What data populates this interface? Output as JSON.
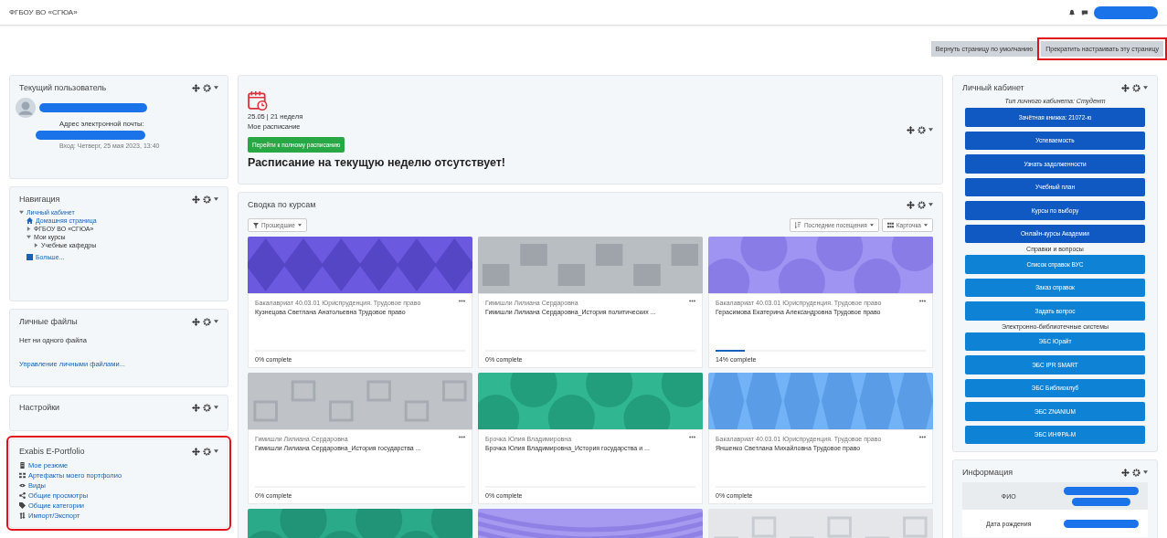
{
  "header": {
    "site_name": "ФГБОУ ВО «СГЮА»"
  },
  "page_buttons": [
    {
      "label": "Вернуть страницу по умолчанию",
      "highlighted": false
    },
    {
      "label": "Прекратить настраивать эту страницу",
      "highlighted": true
    }
  ],
  "current_user_block": {
    "title": "Текущий пользователь",
    "email_label": "Адрес электронной почты:",
    "last_login": "Вход: Четверг, 25 мая 2023, 13:40"
  },
  "navigation_block": {
    "title": "Навигация",
    "tree": [
      {
        "label": "Личный кабинет",
        "kind": "folder",
        "expanded": true,
        "children": [
          {
            "label": "Домашняя страница",
            "kind": "home"
          },
          {
            "label": "ФГБОУ ВО «СГЮА»",
            "kind": "folder",
            "expanded": false
          },
          {
            "label": "Мои курсы",
            "kind": "folder",
            "expanded": true,
            "children": [
              {
                "label": "Учебные кафедры",
                "kind": "folder",
                "expanded": false
              }
            ]
          },
          {
            "label": "Больше...",
            "kind": "more"
          }
        ]
      }
    ]
  },
  "files_block": {
    "title": "Личные файлы",
    "empty_text": "Нет ни одного файла",
    "link": "Управление личными файлами..."
  },
  "settings_block": {
    "title": "Настройки"
  },
  "portfolio_block": {
    "title": "Exabis E-Portfolio",
    "highlighted": true,
    "links": [
      {
        "label": "Мое резюме",
        "kind": "resume"
      },
      {
        "label": "Артефакты моего портфолио",
        "kind": "grid"
      },
      {
        "label": "Виды",
        "kind": "eye"
      },
      {
        "label": "Общие просмотры",
        "kind": "share"
      },
      {
        "label": "Общие категории",
        "kind": "tag"
      },
      {
        "label": "Импорт/Экспорт",
        "kind": "transfer"
      }
    ]
  },
  "schedule_block": {
    "date_week": "25.05 | 21 неделя",
    "subtitle": "Мое расписание",
    "button": "Перейти к полному расписанию",
    "message": "Расписание на текущую неделю отсутствует!"
  },
  "courses_block": {
    "title": "Сводка по курсам",
    "filter": "Прошедшие",
    "sort": "Последние посещения",
    "view": "Карточка",
    "cards": [
      {
        "image": {
          "kind": "picture"
        },
        "category": "Бакалавриат 40.03.01 Юриспруденция. Трудовое право",
        "name": "Кузнецова Светлана Анатольевна Трудовое право",
        "progress": "0% complete"
      },
      {
        "image": {
          "kind": "picture"
        },
        "category": "Гимишли Лилиана Сердаровна",
        "name": "Гимишли Лилиана Сердаровна_История политических ...",
        "progress": "0% complete"
      },
      {
        "image": {
          "kind": "picture"
        },
        "category": "Бакалавриат 40.03.01 Юриспруденция. Трудовое право",
        "name": "Герасимова Екатерина Александровна Трудовое право",
        "progress": "14% complete",
        "level": 0.14
      },
      {
        "image": {
          "kind": "picture"
        },
        "category": "Гимишли Лилиана Сердаровна",
        "name": "Гимишли Лилиана Сердаровна_История государства ...",
        "progress": "0% complete"
      },
      {
        "image": {
          "kind": "picture"
        },
        "category": "Брочка Юлия Владимировна",
        "name": "Брочка Юлия Владимировна_История государства и ...",
        "progress": "0% complete"
      },
      {
        "image": {
          "kind": "picture"
        },
        "category": "Бакалавриат 40.03.01 Юриспруденция. Трудовое право",
        "name": "Яншенко Светлана Михайловна Трудовое право",
        "progress": "0% complete"
      },
      {
        "image": {
          "kind": "picture"
        }
      },
      {
        "image": {
          "kind": "picture"
        }
      },
      {
        "image": {
          "kind": "picture"
        }
      }
    ]
  },
  "cabinet_block": {
    "title": "Личный кабинет",
    "subtitle": "Тип личного кабинета: Студент",
    "items": [
      {
        "kind": "primary",
        "label": "Зачётная книжка: 21072-ю"
      },
      {
        "kind": "primary",
        "label": "Успеваемость"
      },
      {
        "kind": "primary",
        "label": "Узнать задолженности"
      },
      {
        "kind": "primary",
        "label": "Учебный план"
      },
      {
        "kind": "primary",
        "label": "Курсы по выбору"
      },
      {
        "kind": "primary",
        "label": "Онлайн-курсы Академии"
      },
      {
        "kind": "heading",
        "label": "Справки и вопросы"
      },
      {
        "kind": "secondary",
        "label": "Список справок ВУС"
      },
      {
        "kind": "secondary",
        "label": "Заказ справок"
      },
      {
        "kind": "secondary",
        "label": "Задать вопрос"
      },
      {
        "kind": "heading",
        "label": "Электронно-библиотечные системы"
      },
      {
        "kind": "secondary",
        "label": "ЭБС Юрайт"
      },
      {
        "kind": "secondary",
        "label": "ЭБС IPR SMART"
      },
      {
        "kind": "secondary",
        "label": "ЭБС Библиоклуб"
      },
      {
        "kind": "secondary",
        "label": "ЭБС ZNANIUM"
      },
      {
        "kind": "secondary",
        "label": "ЭБС ИНФРА-М"
      }
    ]
  },
  "info_block": {
    "title": "Информация",
    "rows": [
      {
        "label": "ФИО"
      },
      {
        "label": "Дата рождения"
      }
    ]
  }
}
